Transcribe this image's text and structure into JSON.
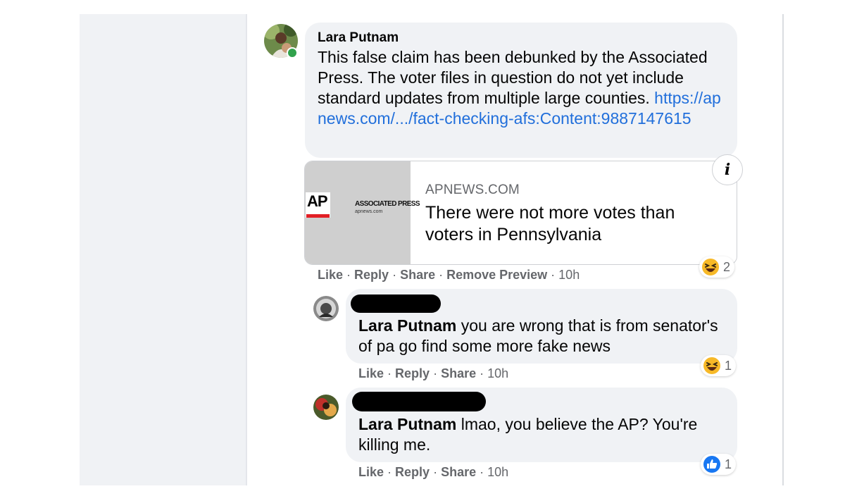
{
  "comment": {
    "author": "Lara Putnam",
    "text": "This false claim has been debunked by the Associated Press. The voter files in question do not yet include standard updates from multiple large counties.",
    "link": "https://apnews.com/.../fact-checking-afs:Content:9887147615",
    "preview": {
      "logo": "AP",
      "brand": "ASSOCIATED PRESS",
      "brand_sub": "apnews.com",
      "domain": "APNEWS.COM",
      "title": "There were not more votes than voters in Pennsylvania"
    },
    "actions": {
      "like": "Like",
      "reply": "Reply",
      "share": "Share",
      "remove_preview": "Remove Preview",
      "time": "10h"
    },
    "reaction": {
      "icon": "haha-emoji-icon",
      "count": "2"
    }
  },
  "replies": [
    {
      "mention": "Lara Putnam",
      "text": "you are wrong that is from senator's of pa go find some more fake news",
      "actions": {
        "like": "Like",
        "reply": "Reply",
        "share": "Share",
        "time": "10h"
      },
      "reaction": {
        "icon": "haha-emoji-icon",
        "count": "1"
      }
    },
    {
      "mention": "Lara Putnam",
      "text": "lmao, you believe the AP? You're killing me.",
      "actions": {
        "like": "Like",
        "reply": "Reply",
        "share": "Share",
        "time": "10h"
      },
      "reaction": {
        "icon": "like-thumb-icon",
        "count": "1"
      }
    }
  ],
  "separator": "·",
  "info_button": "i",
  "colors": {
    "bubble": "#f0f2f5",
    "link": "#216fdb",
    "secondary_text": "#65676b",
    "online": "#31a24c",
    "like_blue": "#1877f2",
    "haha_yellow": "#f7b928",
    "ap_red": "#e21f26"
  }
}
